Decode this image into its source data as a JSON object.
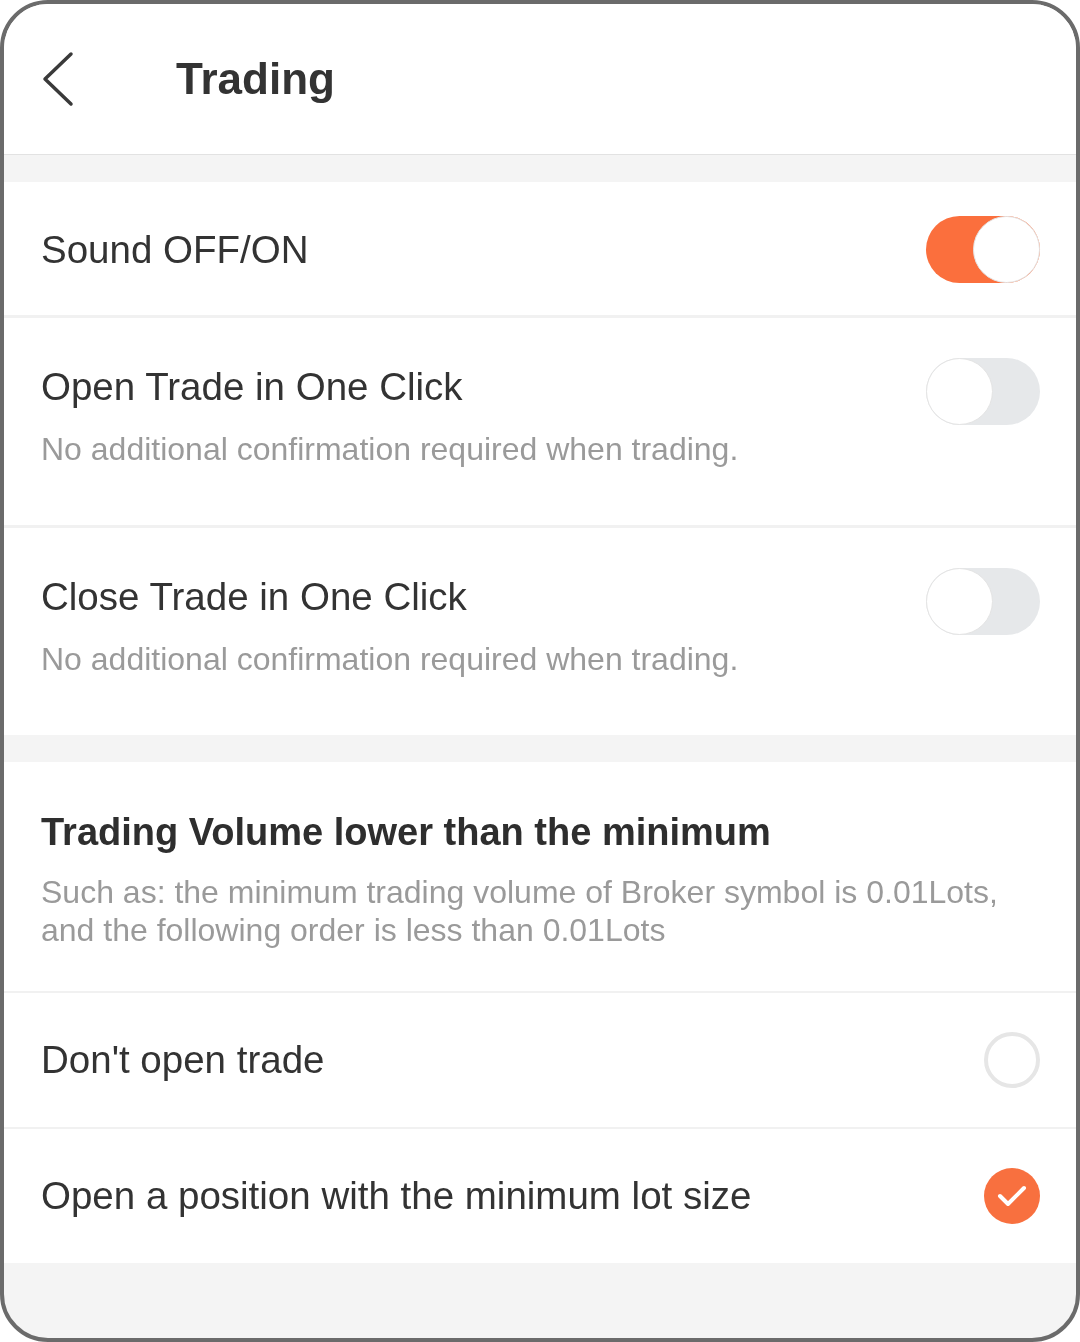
{
  "header": {
    "title": "Trading"
  },
  "toggles": [
    {
      "label": "Sound OFF/ON",
      "on": true
    },
    {
      "label": "Open Trade in One Click",
      "description": "No additional confirmation required when trading.",
      "on": false
    },
    {
      "label": "Close Trade in One Click",
      "description": "No additional confirmation required when trading.",
      "on": false
    }
  ],
  "volume_section": {
    "title": "Trading Volume lower than the minimum",
    "description": "Such as: the minimum trading volume of Broker symbol is 0.01Lots, and the following order is less than 0.01Lots"
  },
  "options": [
    {
      "label": "Don't open trade",
      "selected": false
    },
    {
      "label": "Open a position with the minimum lot size",
      "selected": true
    }
  ]
}
